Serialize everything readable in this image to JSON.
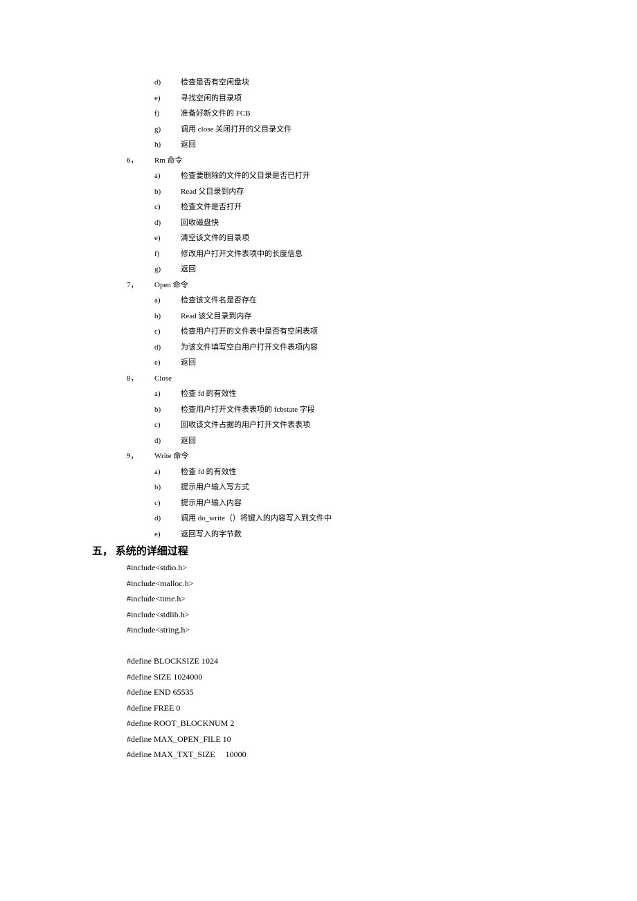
{
  "prelist": [
    {
      "m": "d)",
      "t": "检查是否有空闲盘块"
    },
    {
      "m": "e)",
      "t": "寻找空闲的目录项"
    },
    {
      "m": "f)",
      "t": "准备好新文件的 FCB"
    },
    {
      "m": "g)",
      "t": "调用 close 关闭打开的父目录文件"
    },
    {
      "m": "h)",
      "t": "返回"
    }
  ],
  "items": [
    {
      "num": "6，",
      "title": "Rm 命令",
      "subs": [
        {
          "m": "a)",
          "t": "检查要删除的文件的父目录是否已打开"
        },
        {
          "m": "b)",
          "t": "Read 父目录到内存"
        },
        {
          "m": "c)",
          "t": "检查文件是否打开"
        },
        {
          "m": "d)",
          "t": "回收磁盘快"
        },
        {
          "m": "e)",
          "t": "清空该文件的目录项"
        },
        {
          "m": "f)",
          "t": "修改用户打开文件表项中的长度信息"
        },
        {
          "m": "g)",
          "t": "返回"
        }
      ]
    },
    {
      "num": "7，",
      "title": "Open 命令",
      "subs": [
        {
          "m": "a)",
          "t": "检查该文件名是否存在"
        },
        {
          "m": "b)",
          "t": "Read 该父目录到内存"
        },
        {
          "m": "c)",
          "t": "检查用户打开的文件表中是否有空闲表项"
        },
        {
          "m": "d)",
          "t": "为该文件填写空白用户打开文件表项内容"
        },
        {
          "m": "e)",
          "t": "返回"
        }
      ]
    },
    {
      "num": "8，",
      "title": "Close",
      "subs": [
        {
          "m": "a)",
          "t": "检查 fd 的有效性"
        },
        {
          "m": "b)",
          "t": "检查用户打开文件表表项的 fcbstate 字段"
        },
        {
          "m": "c)",
          "t": "回收该文件占据的用户打开文件表表项"
        },
        {
          "m": "d)",
          "t": "返回"
        }
      ]
    },
    {
      "num": "9，",
      "title": "Write 命令",
      "subs": [
        {
          "m": "a)",
          "t": "检查 fd 的有效性"
        },
        {
          "m": "b)",
          "t": "提示用户输入写方式"
        },
        {
          "m": "c)",
          "t": "提示用户输入内容"
        },
        {
          "m": "d)",
          "t": "调用 do_write（）将键入的内容写入到文件中"
        },
        {
          "m": "e)",
          "t": "返回写入的字节数"
        }
      ]
    }
  ],
  "section_title": "五，  系统的详细过程",
  "code_lines": [
    "#include<stdio.h>",
    "#include<malloc.h>",
    "#include<time.h>",
    "#include<stdlib.h>",
    "#include<string.h>",
    "",
    "#define BLOCKSIZE 1024",
    "#define SIZE 1024000",
    "#define END 65535",
    "#define FREE 0",
    "#define ROOT_BLOCKNUM 2",
    "#define MAX_OPEN_FILE 10",
    "#define MAX_TXT_SIZE     10000"
  ]
}
